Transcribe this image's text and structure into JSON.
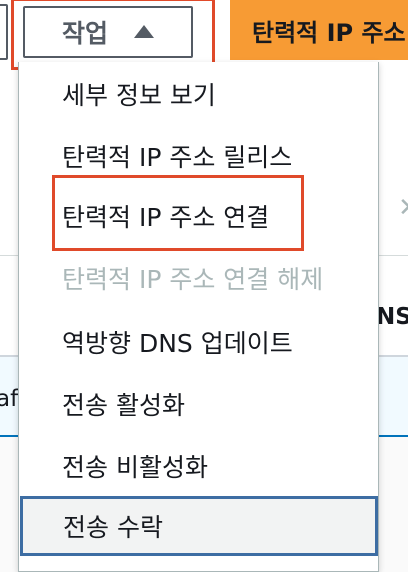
{
  "toolbar": {
    "actions_label": "작업",
    "actions_icon": "caret-up-icon",
    "primary_label": "탄력적 IP 주소 할당"
  },
  "background": {
    "close_glyph": "✕",
    "column_header_fragment": "NS",
    "row_fragment": "af"
  },
  "menu": {
    "items": [
      {
        "label": "세부 정보 보기",
        "state": "enabled"
      },
      {
        "label": "탄력적 IP 주소 릴리스",
        "state": "enabled"
      },
      {
        "label": "탄력적 IP 주소 연결",
        "state": "highlighted-callout"
      },
      {
        "label": "탄력적 IP 주소 연결 해제",
        "state": "disabled"
      },
      {
        "label": "역방향 DNS 업데이트",
        "state": "enabled"
      },
      {
        "label": "전송 활성화",
        "state": "enabled"
      },
      {
        "label": "전송 비활성화",
        "state": "enabled"
      },
      {
        "label": "전송 수락",
        "state": "focused"
      }
    ]
  },
  "colors": {
    "primary_button": "#f79b34",
    "callout_border": "#e04a2a",
    "focus_border": "#3d6da3",
    "disabled_text": "#aab7b8",
    "selected_row_bg": "#f1faff"
  }
}
